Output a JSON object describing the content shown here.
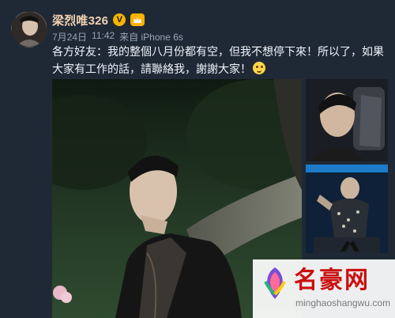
{
  "user": {
    "name": "梁烈唯326",
    "verified_icon": "v-badge-icon",
    "member_icon": "crown-icon"
  },
  "meta": {
    "date": "7月24日",
    "time": "11:42",
    "source": "来自 iPhone 6s"
  },
  "post": {
    "text": "各方好友：我的整個八月份都有空，但我不想停下來！所以了，如果大家有工作的話，請聯絡我，謝謝大家！",
    "emoji": "blowing-kiss-emoji"
  },
  "images": {
    "main_photo": "portrait-photo",
    "thumb_top": "selfie-car-photo",
    "thumb_bottom": "stage-performance-photo"
  },
  "watermark": {
    "title": "名豪网",
    "url": "minghaoshangwu.com"
  },
  "colors": {
    "background": "#1f2936",
    "username": "#f1d2b2",
    "meta": "#96a2b3",
    "watermark_red": "#cb0f0f"
  }
}
